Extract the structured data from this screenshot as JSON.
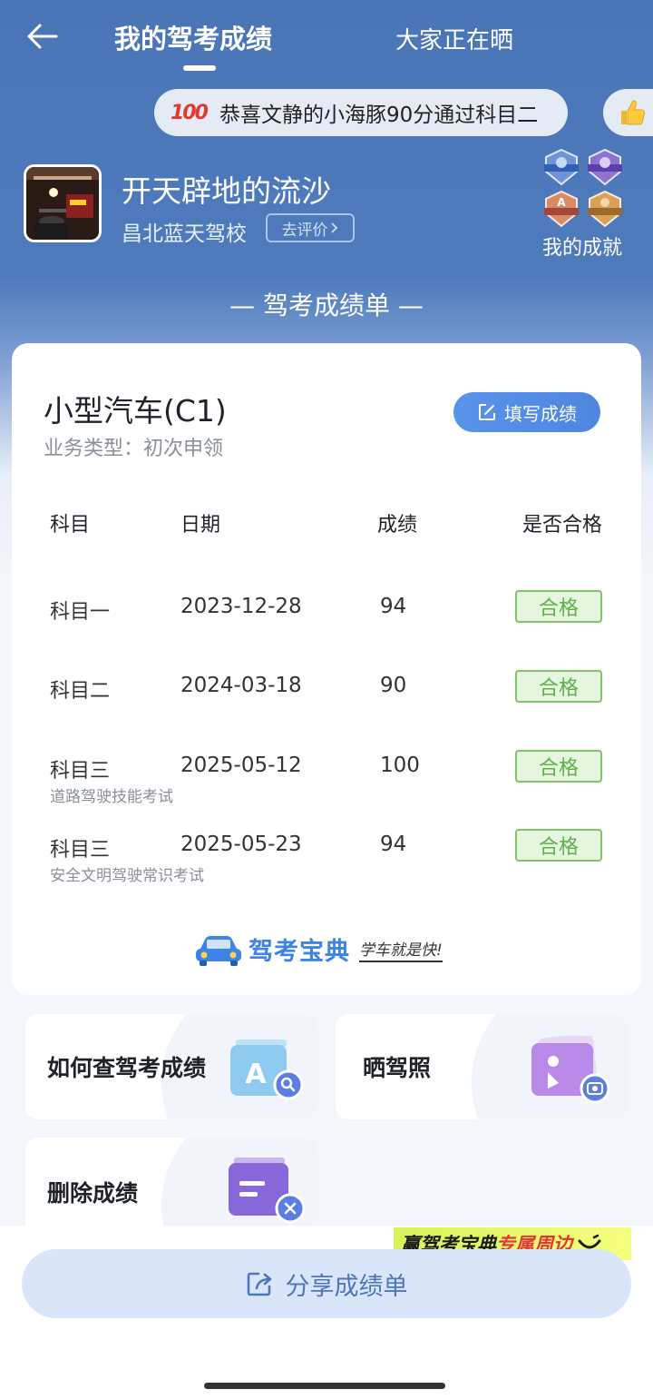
{
  "nav": {
    "active_tab": "我的驾考成绩",
    "other_tab": "大家正在晒"
  },
  "ticker": {
    "emoji_text": "100",
    "message": "恭喜文静的小海豚90分通过科目二"
  },
  "profile": {
    "username": "开天辟地的流沙",
    "school": "昌北蓝天驾校",
    "review_label": "去评价",
    "achievements_label": "我的成就"
  },
  "section_title": "— 驾考成绩单 —",
  "card": {
    "license_title": "小型汽车(C1)",
    "business_type": "业务类型：初次申领",
    "fill_button": "填写成绩",
    "headers": {
      "subject": "科目",
      "date": "日期",
      "score": "成绩",
      "passed": "是否合格"
    },
    "rows": [
      {
        "subject": "科目一",
        "date": "2023-12-28",
        "score": "94",
        "result": "合格",
        "sub": ""
      },
      {
        "subject": "科目二",
        "date": "2024-03-18",
        "score": "90",
        "result": "合格",
        "sub": ""
      },
      {
        "subject": "科目三",
        "date": "2025-05-12",
        "score": "100",
        "result": "合格",
        "sub": "道路驾驶技能考试"
      },
      {
        "subject": "科目三",
        "date": "2025-05-23",
        "score": "94",
        "result": "合格",
        "sub": "安全文明驾驶常识考试"
      }
    ],
    "brand_name": "驾考宝典",
    "brand_slogan": "学车就是快!"
  },
  "tiles": {
    "query": "如何查驾考成绩",
    "show_license": "晒驾照",
    "delete": "删除成绩"
  },
  "promo": {
    "part1": "赢驾考宝典",
    "part2": "专属周边"
  },
  "share_button": "分享成绩单",
  "colors": {
    "brand_blue": "#4a75b6",
    "pass_green": "#5db04a",
    "button_blue": "#5a93ea"
  }
}
